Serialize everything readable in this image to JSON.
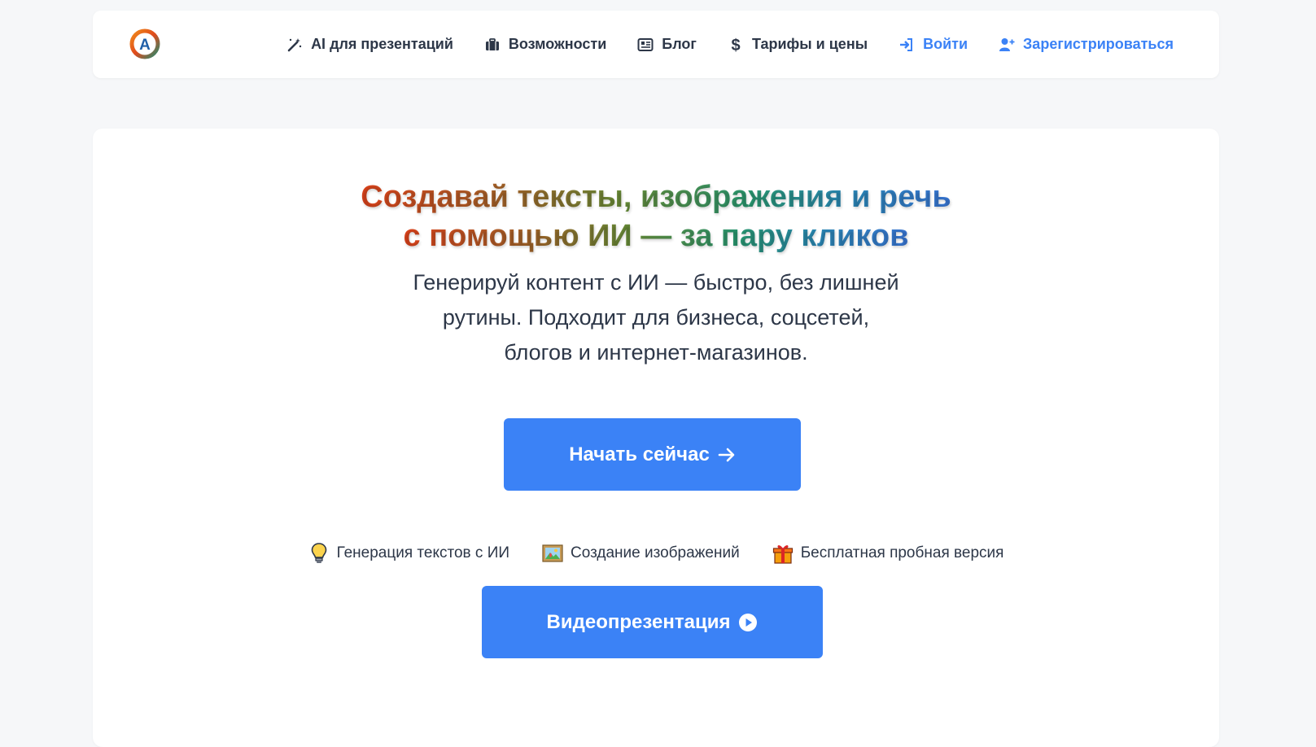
{
  "nav": {
    "logo": {
      "letter": "A",
      "icon": "logo-ring-icon"
    },
    "items": [
      {
        "label": "AI для презентаций",
        "icon": "magic-wand-icon"
      },
      {
        "label": "Возможности",
        "icon": "briefcase-icon"
      },
      {
        "label": "Блог",
        "icon": "newspaper-icon"
      },
      {
        "label": "Тарифы и цены",
        "icon": "dollar-icon"
      },
      {
        "label": "Войти",
        "icon": "login-icon"
      },
      {
        "label": "Зарегистрироваться",
        "icon": "user-plus-icon"
      }
    ]
  },
  "hero": {
    "headline_line1": "Создавай тексты, изображения и речь",
    "headline_line2": "с помощью ИИ — за пару кликов",
    "subtitle_line1": "Генерируй контент с ИИ — быстро, без лишней",
    "subtitle_line2": "рутины. Подходит для бизнеса, соцсетей,",
    "subtitle_line3": "блогов и интернет-магазинов.",
    "start_button": "Начать сейчас",
    "features": [
      {
        "label": "Генерация текстов с ИИ",
        "icon": "lightbulb-icon"
      },
      {
        "label": "Создание изображений",
        "icon": "framed-picture-icon"
      },
      {
        "label": "Бесплатная пробная версия",
        "icon": "gift-icon"
      }
    ],
    "video_button": "Видеопрезентация"
  },
  "colors": {
    "accent": "#3b82f6",
    "text": "#2d3748",
    "page_background": "#f6f7f9",
    "card_background": "#ffffff"
  }
}
